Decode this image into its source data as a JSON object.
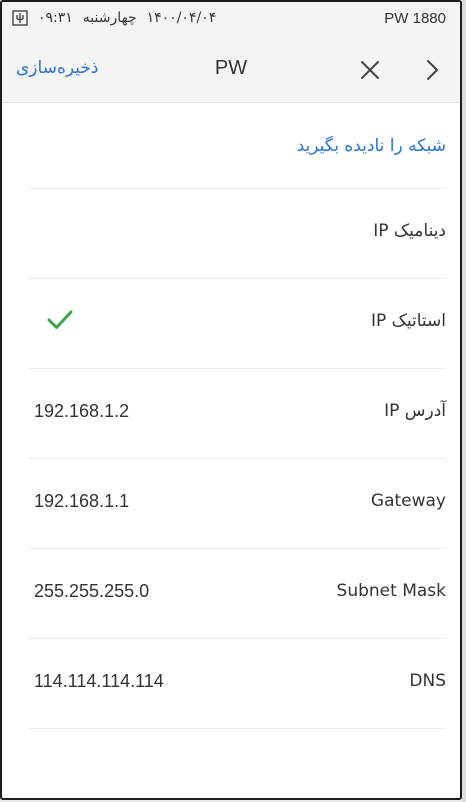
{
  "status_bar": {
    "time": "۰۹:۳۱",
    "day": "چهارشنبه",
    "date": "۱۴۰۰/۰۴/۰۴",
    "device": "PW 1880",
    "usb_icon": "usb-icon"
  },
  "header": {
    "save_label": "ذخیره‌سازی",
    "title": "PW",
    "close_icon": "close-icon",
    "back_icon": "chevron-right-icon"
  },
  "list": {
    "forget_network": "شبکه را نادیده بگیرید",
    "dynamic_ip": "دینامیک IP",
    "static_ip": "استاتیک IP",
    "static_selected_icon": "check-icon",
    "ip_address_label": "آدرس IP",
    "ip_address_value": "192.168.1.2",
    "gateway_label": "Gateway",
    "gateway_value": "192.168.1.1",
    "subnet_label": "Subnet Mask",
    "subnet_value": "255.255.255.0",
    "dns_label": "DNS",
    "dns_value": "114.114.114.114"
  },
  "colors": {
    "accent": "#2d73d6",
    "check": "#3aa64a",
    "text": "#333333",
    "bar_bg": "#f4f4f4"
  }
}
